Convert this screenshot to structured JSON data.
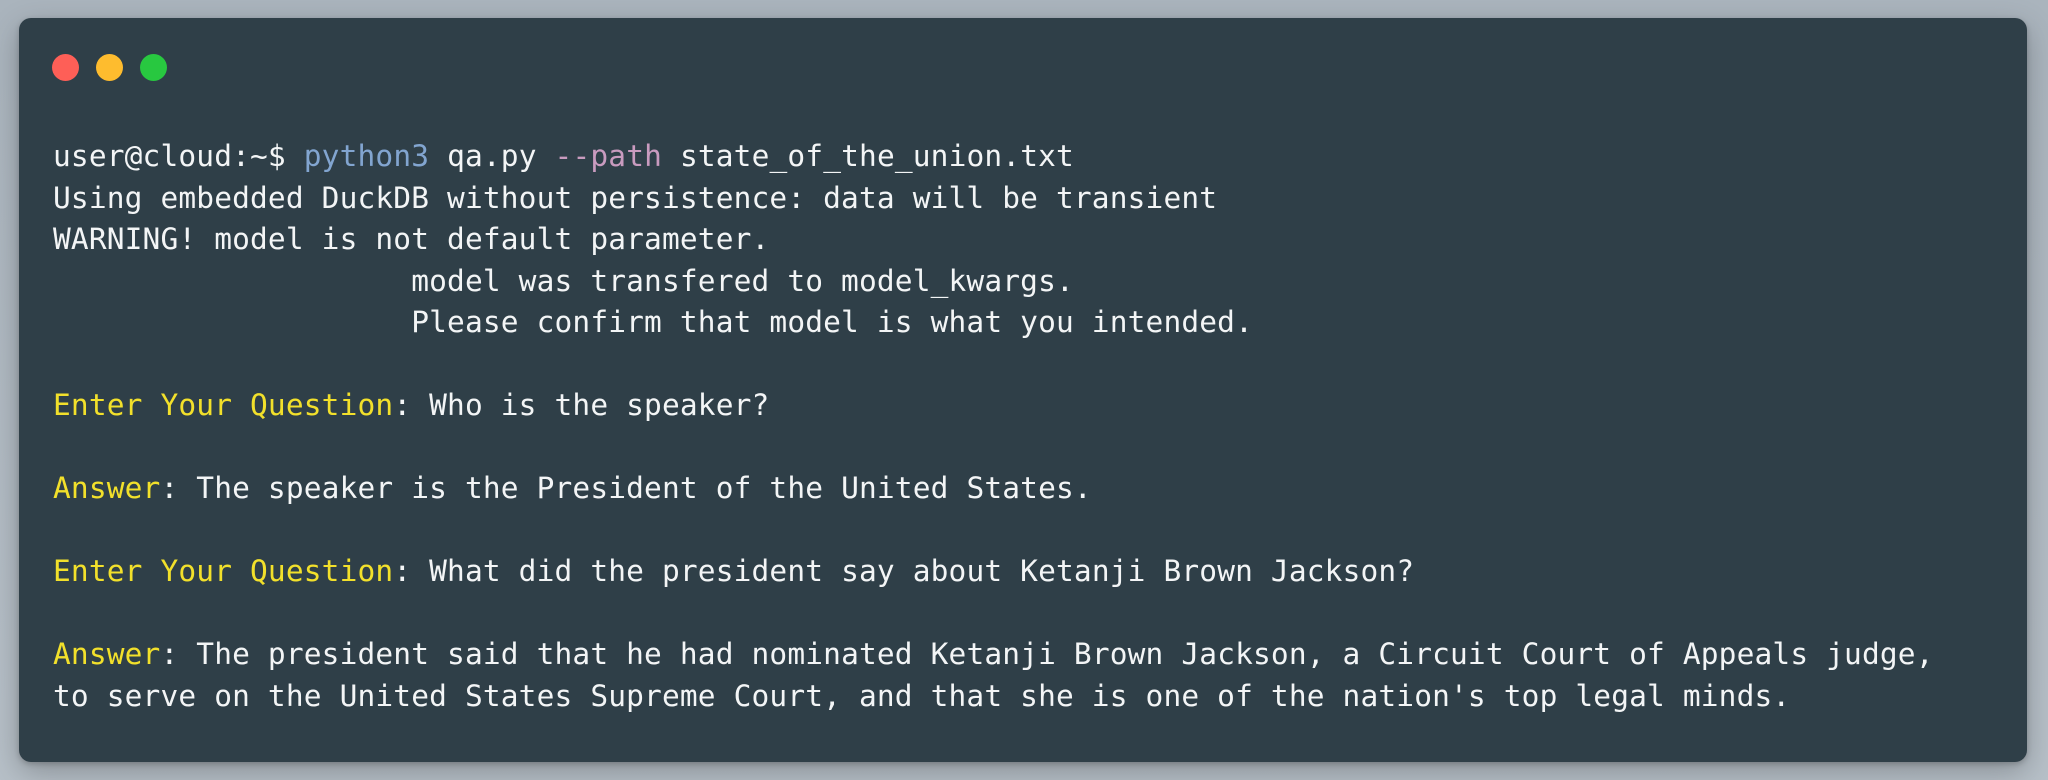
{
  "window": {
    "colors": {
      "background": "#2f3f48",
      "close": "#fe5f57",
      "minimize": "#febc2e",
      "maximize": "#28c840",
      "text": "#f3f5f6",
      "command": "#82a5d0",
      "flag": "#c99bbf",
      "label": "#f2e02b"
    }
  },
  "terminal": {
    "command_line": {
      "prompt": "user@cloud:~$",
      "program": "python3",
      "script": "qa.py",
      "flag": "--path",
      "argument": "state_of_the_union.txt"
    },
    "log_lines": [
      "Using embedded DuckDB without persistence: data will be transient",
      "WARNING! model is not default parameter.",
      "                    model was transfered to model_kwargs.",
      "                    Please confirm that model is what you intended."
    ],
    "exchanges": [
      {
        "question_label": "Enter Your Question",
        "question": ": Who is the speaker?",
        "answer_label": "Answer",
        "answer_lines": [
          ": The speaker is the President of the United States."
        ]
      },
      {
        "question_label": "Enter Your Question",
        "question": ": What did the president say about Ketanji Brown Jackson?",
        "answer_label": "Answer",
        "answer_lines": [
          ": The president said that he had nominated Ketanji Brown Jackson, a Circuit Court of Appeals judge,",
          "to serve on the United States Supreme Court, and that she is one of the nation's top legal minds."
        ]
      }
    ]
  }
}
